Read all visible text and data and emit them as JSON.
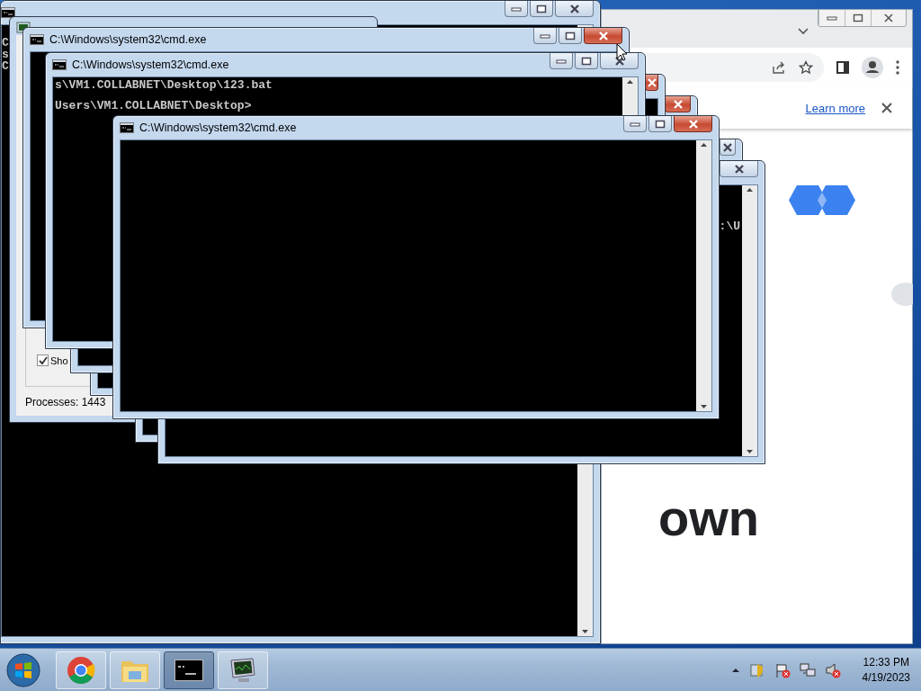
{
  "console_windows": [
    {
      "active": false,
      "lines": [
        "C",
        "s",
        "C"
      ]
    },
    {
      "active": false
    },
    {
      "active": false,
      "lines": [
        ":\\U"
      ]
    },
    {
      "active": true
    },
    {
      "active": true
    },
    {
      "active": true,
      "title": "C:\\Windows\\system32\\cmd.exe"
    },
    {
      "active": false,
      "title": "C:\\Windows\\system32\\cmd.exe",
      "lines": [
        "s\\VM1.COLLABNET\\Desktop\\123.bat",
        "Users\\VM1.COLLABNET\\Desktop>"
      ]
    },
    {
      "active": true,
      "title": "C:\\Windows\\system32\\cmd.exe"
    }
  ],
  "task_manager": {
    "checkbox": {
      "label": "Sho",
      "checked": true
    },
    "status": "Processes: 1443"
  },
  "browser": {
    "infobar": {
      "link": "Learn more"
    },
    "heading": "own"
  },
  "taskbar": {
    "items": [
      {
        "kind": "chrome",
        "selected": false
      },
      {
        "kind": "folder",
        "selected": false
      },
      {
        "kind": "console",
        "selected": true
      },
      {
        "kind": "monitor",
        "selected": false
      }
    ],
    "clock": {
      "time": "12:33 PM",
      "date": "4/19/2023"
    }
  }
}
